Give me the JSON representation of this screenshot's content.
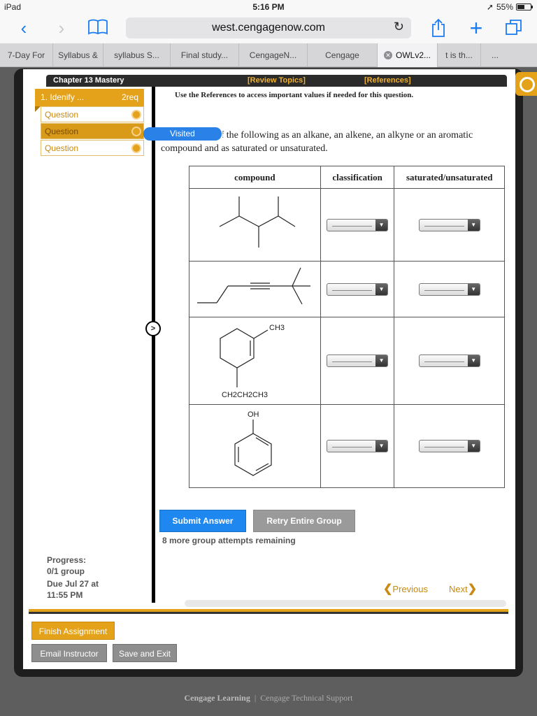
{
  "status": {
    "device": "iPad",
    "time": "5:16 PM",
    "battery": "55%"
  },
  "browser": {
    "url": "west.cengagenow.com",
    "tabs": [
      {
        "label": "7-Day For"
      },
      {
        "label": "Syllabus &"
      },
      {
        "label": "syllabus S..."
      },
      {
        "label": "Final study..."
      },
      {
        "label": "CengageN..."
      },
      {
        "label": "Cengage"
      },
      {
        "label": "OWLv2..."
      },
      {
        "label": "t is th..."
      },
      {
        "label": "..."
      }
    ]
  },
  "assignment": {
    "title": "Chapter 13 Mastery",
    "review_topics": "[Review Topics]",
    "references": "[References]",
    "question_group": {
      "number": "1. Idenify ...",
      "req": "2req"
    },
    "questions": [
      {
        "label": "Question"
      },
      {
        "label": "Question"
      },
      {
        "label": "Question"
      }
    ],
    "visited_label": "Visited",
    "refs_note": "Use the References to access important values if needed for this question.",
    "instruction": "Classify each of the following as an alkane, an alkene, an alkyne or an aromatic compound and as saturated or unsaturated.",
    "table": {
      "headers": [
        "compound",
        "classification",
        "saturated/unsaturated"
      ],
      "labels": {
        "ch3": "CH3",
        "propyl": "CH2CH2CH3",
        "oh": "OH"
      }
    },
    "submit_label": "Submit Answer",
    "retry_label": "Retry Entire Group",
    "attempts": "8 more group attempts remaining",
    "progress_label": "Progress:",
    "progress_value": "0/1 group",
    "due_line1": "Due Jul 27 at",
    "due_line2": "11:55 PM",
    "prev_label": "Previous",
    "next_label": "Next",
    "finish_label": "Finish Assignment",
    "email_label": "Email Instructor",
    "save_label": "Save and Exit"
  },
  "footer": {
    "left": "Cengage Learning",
    "sep": "|",
    "right": "Cengage Technical Support"
  },
  "colors": {
    "accent": "#e3a21a",
    "button_blue": "#1e88f0",
    "safari_blue": "#1a7bf2"
  }
}
